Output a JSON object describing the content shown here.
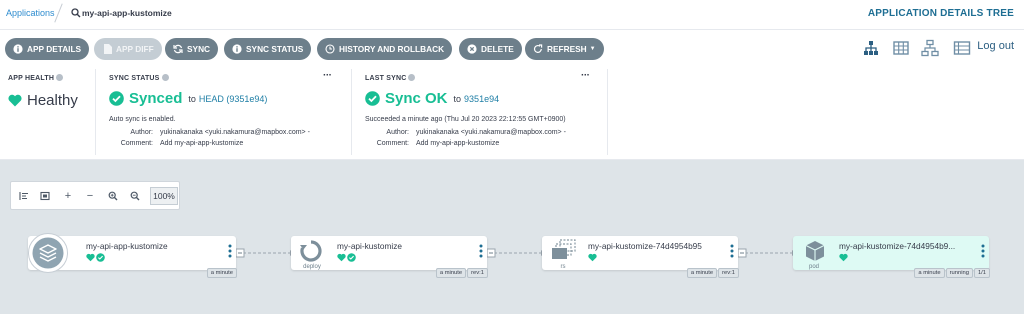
{
  "breadcrumb": {
    "apps_label": "Applications",
    "app_name": "my-api-app-kustomize"
  },
  "view_title": "APPLICATION DETAILS TREE",
  "toolbar": {
    "buttons": [
      {
        "label": "APP DETAILS",
        "icon": "info-circle-icon"
      },
      {
        "label": "APP DIFF",
        "icon": "file-diff-icon"
      },
      {
        "label": "SYNC",
        "icon": "sync-icon"
      },
      {
        "label": "SYNC STATUS",
        "icon": "info-circle-icon"
      },
      {
        "label": "HISTORY AND ROLLBACK",
        "icon": "history-icon"
      },
      {
        "label": "DELETE",
        "icon": "delete-circle-icon"
      },
      {
        "label": "REFRESH",
        "icon": "refresh-icon"
      }
    ],
    "logout_label": "Log out",
    "view_modes": [
      "tree-view-icon",
      "pods-grid-icon",
      "network-view-icon",
      "list-view-icon"
    ]
  },
  "app_health": {
    "label": "APP HEALTH",
    "value": "Healthy",
    "color": "#18be94"
  },
  "sync_status": {
    "label": "SYNC STATUS",
    "value": "Synced",
    "to": "to",
    "revision": "HEAD (9351e94)",
    "auto_sync": "Auto sync is enabled.",
    "author_key": "Author:",
    "author": "yukinakanaka <yuki.nakamura@mapbox.com> -",
    "comment_key": "Comment:",
    "comment": "Add my-api-app-kustomize",
    "more": "···"
  },
  "last_sync": {
    "label": "LAST SYNC",
    "value": "Sync OK",
    "to": "to",
    "revision": "9351e94",
    "time": "Succeeded a minute ago (Thu Jul 20 2023 22:12:55 GMT+0900)",
    "author_key": "Author:",
    "author": "yukinakanaka <yuki.nakamura@mapbox.com> -",
    "comment_key": "Comment:",
    "comment": "Add my-api-app-kustomize",
    "more": "···"
  },
  "zoom": {
    "value": "100%"
  },
  "nodes": [
    {
      "name": "my-api-app-kustomize",
      "kind": "",
      "tags": [
        "a minute"
      ]
    },
    {
      "name": "my-api-kustomize",
      "kind": "deploy",
      "tags": [
        "a minute",
        "rev:1"
      ]
    },
    {
      "name": "my-api-kustomize-74d4954b95",
      "kind": "rs",
      "tags": [
        "a minute",
        "rev:1"
      ]
    },
    {
      "name": "my-api-kustomize-74d4954b9...",
      "kind": "pod",
      "tags": [
        "a minute",
        "running",
        "1/1"
      ]
    }
  ],
  "colors": {
    "healthy": "#18be94",
    "button": "#6d7f8b",
    "button_disabled": "#c4cdd4",
    "canvas": "#dee4e8",
    "link": "#2e8ccf"
  }
}
